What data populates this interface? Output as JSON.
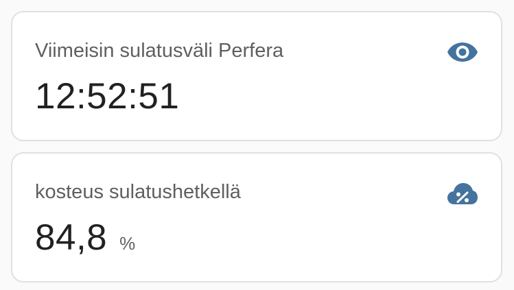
{
  "accent_color": "#44739e",
  "cards": [
    {
      "name": "Viimeisin sulatusväli Perfera",
      "value": "12:52:51",
      "unit": "",
      "icon": "eye-icon"
    },
    {
      "name": "kosteus sulatushetkellä",
      "value": "84,8",
      "unit": "%",
      "icon": "cloud-percent-icon"
    }
  ]
}
